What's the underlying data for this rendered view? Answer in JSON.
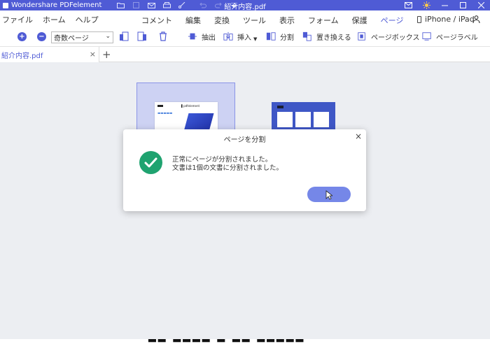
{
  "titlebar": {
    "app_name": "Wondershare PDFelement",
    "doc_title": "紹介内容.pdf"
  },
  "menu": {
    "left": [
      "ファイル",
      "ホーム",
      "ヘルプ"
    ],
    "center": [
      "コメント",
      "編集",
      "変換",
      "ツール",
      "表示",
      "フォーム",
      "保護",
      "ページ"
    ],
    "active": "ページ",
    "device": "iPhone / iPad"
  },
  "toolbar": {
    "page_select_value": "奇数ページ",
    "extract_label": "抽出",
    "insert_label": "挿入",
    "split_label": "分割",
    "replace_label": "置き換える",
    "pagebox_label": "ページボックス",
    "pagelabel_label": "ページラベル"
  },
  "tabs": {
    "doc_tab_label": "紹介内容.pdf",
    "add_symbol": "+"
  },
  "dialog": {
    "title": "ページを分割",
    "line1": "正常にページが分割されました。",
    "line2": "文書は1個の文書に分割されました。",
    "close_symbol": "×"
  },
  "colors": {
    "accent": "#4f5bd5",
    "success": "#1fa370",
    "button": "#7587e8"
  }
}
